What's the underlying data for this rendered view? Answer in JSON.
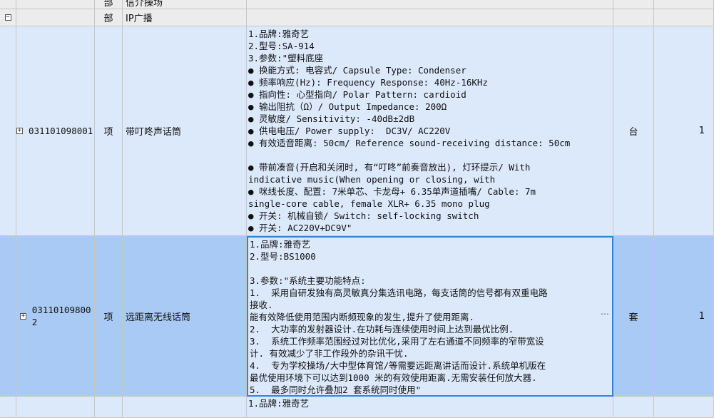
{
  "rows": [
    {
      "unit": "部",
      "name": "信介操场"
    },
    {
      "unit": "部",
      "name": "IP广播"
    },
    {
      "code": "031101098001",
      "unit": "项",
      "name": "带叮咚声话筒",
      "measure": "台",
      "qty": "1",
      "spec": [
        "1.品牌:雅奇艺",
        "2.型号:SA-914",
        "3.参数:\"塑料底座",
        "● 换能方式: 电容式/ Capsule Type: Condenser",
        "● 频率响应(Hz): Frequency Response: 40Hz-16KHz",
        "● 指向性: 心型指向/ Polar Pattern: cardioid",
        "● 输出阻抗（Ω）/ Output Impedance: 200Ω",
        "● 灵敏度/ Sensitivity: -40dB±2dB",
        "● 供电电压/ Power supply:  DC3V/ AC220V",
        "● 有效适音距离: 50cm/ Reference sound-receiving distance: 50cm",
        "",
        "● 带前凑音(开启和关闭时, 有“叮咚”前奏音放出), 灯环提示/ With",
        "indicative music(When opening or closing, with",
        "● 咪线长度、配置: 7米单芯、卡龙母+ 6.35单声道插嘴/ Cable: 7m",
        "single-core cable, female XLR+ 6.35 mono plug",
        "● 开关: 机械自锁/ Switch: self-locking switch",
        "● 开关: AC220V+DC9V\""
      ]
    },
    {
      "code": "031101098002",
      "unit": "项",
      "name": "远距离无线话筒",
      "measure": "套",
      "qty": "1",
      "spec": [
        "1.品牌:雅奇艺",
        "2.型号:BS1000",
        "",
        "3.参数:\"系统主要功能特点:",
        "1.  采用自研发独有高灵敏真分集选讯电路，每支话筒的信号都有双重电路",
        "接收.",
        "能有效降低使用范围内断频现象的发生,提升了使用距离.",
        "2.  大功率的发射器设计.在功耗与连续使用时间上达到最优比例.",
        "3.  系统工作频率范围经过对比优化,采用了左右通道不同频率的窄带宽设",
        "计. 有效减少了非工作段外的杂讯干忧.",
        "4.  专为学校操场/大中型体育馆/等需要远距离讲话而设计.系统单机版在",
        "最优使用环境下可以达到1000 米的有效使用距离.无需安装任何放大器.",
        "5.  最多同时允许叠加2 套系统同时使用\""
      ]
    },
    {
      "spec0": "1.品牌:雅奇艺"
    }
  ]
}
